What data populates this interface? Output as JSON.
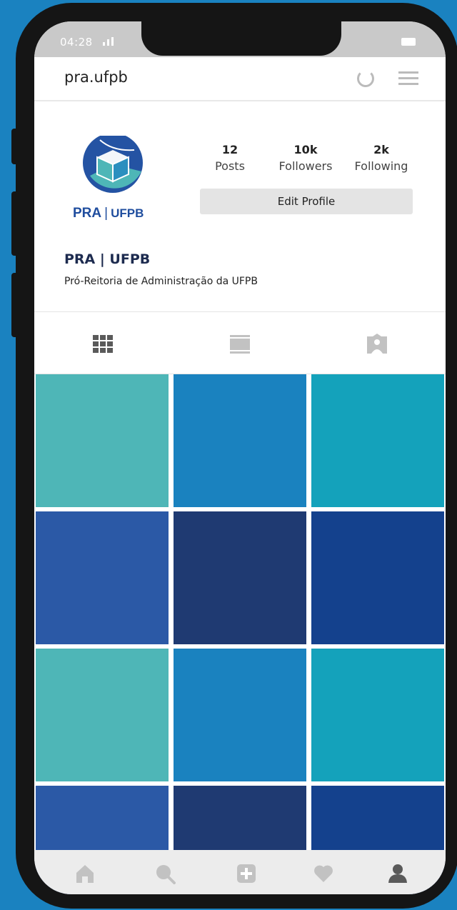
{
  "status_bar": {
    "time": "04:28"
  },
  "app_bar": {
    "username": "pra.ufpb"
  },
  "profile": {
    "logo": {
      "primary": "PRA",
      "secondary": "UFPB"
    },
    "stats": [
      {
        "value": "12",
        "label": "Posts"
      },
      {
        "value": "10k",
        "label": "Followers"
      },
      {
        "value": "2k",
        "label": "Following"
      }
    ],
    "edit_button_label": "Edit Profile",
    "display_name": "PRA | UFPB",
    "bio": "Pró-Reitoria de Administração da UFPB"
  },
  "tabs": [
    {
      "icon": "grid-icon",
      "active": true
    },
    {
      "icon": "feed-icon",
      "active": false
    },
    {
      "icon": "tagged-icon",
      "active": false
    }
  ],
  "grid_colors": [
    "#4eb6b7",
    "#1a82bf",
    "#14a2bb",
    "#2b59a6",
    "#1f3a72",
    "#14418d",
    "#4eb6b7",
    "#1a82bf",
    "#14a2bb",
    "#2b59a6",
    "#1f3a72",
    "#14418d"
  ],
  "bottom_nav": [
    "home-icon",
    "search-icon",
    "add-post-icon",
    "heart-icon",
    "profile-icon"
  ],
  "colors": {
    "background": "#1a82c0",
    "brand_dark": "#1f4d9e",
    "brand_teal": "#4eb6b7",
    "icon_inactive": "#c2c2c2",
    "icon_active": "#5a5a5a"
  }
}
